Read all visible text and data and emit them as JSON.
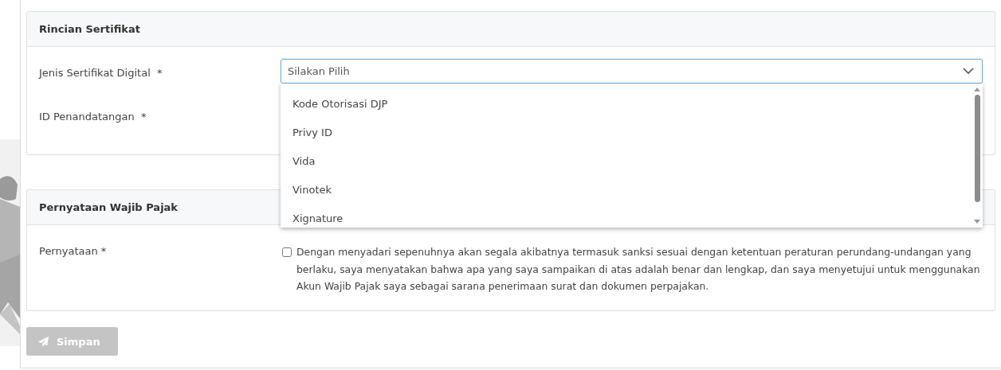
{
  "certificate_section": {
    "title": "Rincian Sertifikat",
    "fields": [
      {
        "label": "Jenis Sertifikat Digital",
        "required": "*",
        "kind": "select",
        "placeholder": "Silakan Pilih"
      },
      {
        "label": "ID Penandatangan",
        "required": "*",
        "kind": "hidden"
      }
    ]
  },
  "dropdown": {
    "expanded": true,
    "options": [
      {
        "label": "Kode Otorisasi DJP",
        "selected": false
      },
      {
        "label": "Privy ID",
        "selected": false
      },
      {
        "label": "Vida",
        "selected": false
      },
      {
        "label": "Vinotek",
        "selected": false
      },
      {
        "label": "Xignature",
        "selected": false
      }
    ]
  },
  "statement_section": {
    "title": "Pernyataan Wajib Pajak",
    "label": "Pernyataan *",
    "checked": false,
    "text": "Dengan menyadari sepenuhnya akan segala akibatnya termasuk sanksi sesuai dengan ketentuan peraturan perundang-undangan yang berlaku, saya menyatakan bahwa apa yang saya sampaikan di atas adalah benar dan lengkap, dan saya menyetujui untuk menggunakan Akun Wajib Pajak saya sebagai sarana penerimaan surat dan dokumen perpajakan."
  },
  "save_button": {
    "label": "Simpan",
    "disabled": true
  }
}
